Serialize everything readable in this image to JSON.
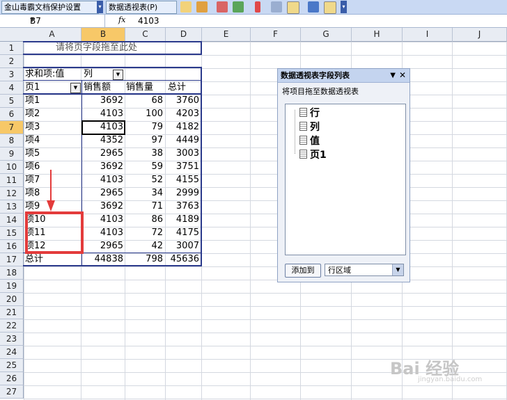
{
  "toolbar": {
    "protect_label": "金山毒霸文档保护设置",
    "pivot_menu_label": "数据透视表(P)"
  },
  "formula_bar": {
    "name_box": "B7",
    "fx": "fx",
    "value": "4103"
  },
  "columns": [
    "A",
    "B",
    "C",
    "D",
    "E",
    "F",
    "G",
    "H",
    "I",
    "J"
  ],
  "rows": [
    "1",
    "2",
    "3",
    "4",
    "5",
    "6",
    "7",
    "8",
    "9",
    "10",
    "11",
    "12",
    "13",
    "14",
    "15",
    "16",
    "17",
    "18",
    "19",
    "20",
    "21",
    "22",
    "23",
    "24",
    "25",
    "26",
    "27"
  ],
  "pivot": {
    "page_drop_hint": "请将页字段拖至此处",
    "sum_label": "求和项:值",
    "col_field": "列",
    "row_field": "页1",
    "headers": [
      "销售额",
      "销售量",
      "总计"
    ],
    "data": [
      [
        "项1",
        "3692",
        "68",
        "3760"
      ],
      [
        "项2",
        "4103",
        "100",
        "4203"
      ],
      [
        "项3",
        "4103",
        "79",
        "4182"
      ],
      [
        "项4",
        "4352",
        "97",
        "4449"
      ],
      [
        "项5",
        "2965",
        "38",
        "3003"
      ],
      [
        "项6",
        "3692",
        "59",
        "3751"
      ],
      [
        "项7",
        "4103",
        "52",
        "4155"
      ],
      [
        "项8",
        "2965",
        "34",
        "2999"
      ],
      [
        "项9",
        "3692",
        "71",
        "3763"
      ],
      [
        "项10",
        "4103",
        "86",
        "4189"
      ],
      [
        "项11",
        "4103",
        "72",
        "4175"
      ],
      [
        "项12",
        "2965",
        "42",
        "3007"
      ]
    ],
    "total": [
      "总计",
      "44838",
      "798",
      "45636"
    ]
  },
  "field_list": {
    "title": "数据透视表字段列表",
    "subtitle": "将项目拖至数据透视表",
    "fields": [
      "行",
      "列",
      "值",
      "页1"
    ],
    "add_button": "添加到",
    "area_select": "行区域"
  },
  "watermark": {
    "main": "Bai 经验",
    "sub": "jingyan.baidu.com"
  }
}
